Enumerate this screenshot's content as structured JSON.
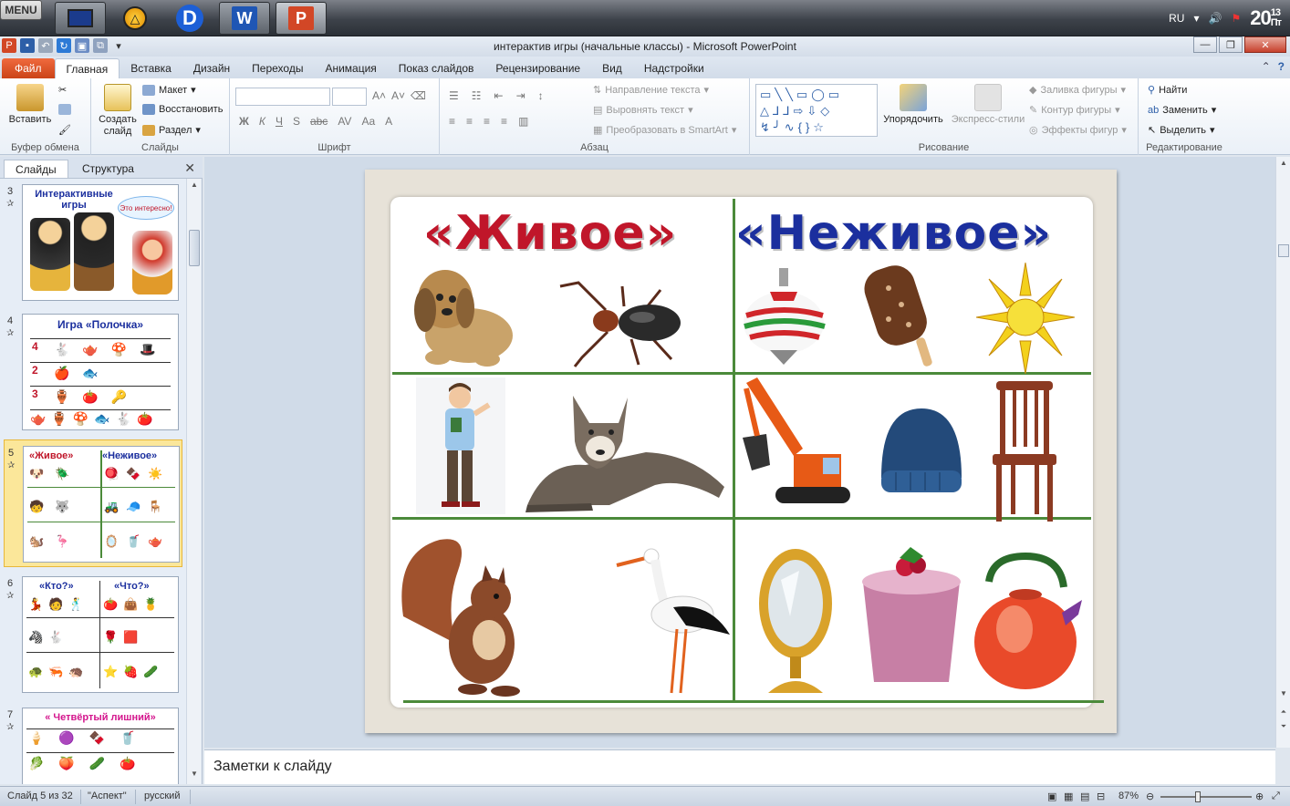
{
  "taskbar": {
    "menu_label": "MENU",
    "language": "RU",
    "clock_hour": "20",
    "clock_minutes": "13",
    "clock_suffix": "Пт"
  },
  "window": {
    "title": "интерактив игры (начальные классы)  -  Microsoft PowerPoint"
  },
  "ribbon_tabs": [
    "Файл",
    "Главная",
    "Вставка",
    "Дизайн",
    "Переходы",
    "Анимация",
    "Показ слайдов",
    "Рецензирование",
    "Вид",
    "Надстройки"
  ],
  "ribbon": {
    "clipboard": {
      "paste": "Вставить",
      "label": "Буфер обмена"
    },
    "slides": {
      "create": "Создать слайд",
      "layout": "Макет",
      "reset": "Восстановить",
      "section": "Раздел",
      "label": "Слайды"
    },
    "font": {
      "label": "Шрифт",
      "bold": "Ж",
      "italic": "К",
      "underline": "Ч",
      "strike": "S",
      "shadow": "abc",
      "spacing": "AV",
      "case": "Aa",
      "color": "A"
    },
    "paragraph": {
      "label": "Абзац",
      "text_direction": "Направление текста",
      "align_text": "Выровнять текст",
      "smartart": "Преобразовать в SmartArt"
    },
    "drawing": {
      "label": "Рисование",
      "arrange": "Упорядочить",
      "quick_styles": "Экспресс-стили",
      "fill": "Заливка фигуры",
      "outline": "Контур фигуры",
      "effects": "Эффекты фигур"
    },
    "editing": {
      "label": "Редактирование",
      "find": "Найти",
      "replace": "Заменить",
      "select": "Выделить"
    }
  },
  "pane": {
    "tab_slides": "Слайды",
    "tab_outline": "Структура",
    "thumbnails": [
      {
        "number": "3",
        "title": "Интерактивные игры",
        "bubble": "Это интересно!"
      },
      {
        "number": "4",
        "title": "Игра «Полочка»",
        "rows": [
          "4",
          "2",
          "3"
        ]
      },
      {
        "number": "5",
        "title_left": "«Живое»",
        "title_right": "«Неживое»"
      },
      {
        "number": "6",
        "title_left": "«Кто?»",
        "title_right": "«Что?»"
      },
      {
        "number": "7",
        "title": "« Четвёртый лишний»"
      }
    ]
  },
  "slide": {
    "heading_left": "«Живое»",
    "heading_right": "«Неживое»",
    "living": [
      "dog",
      "beetle",
      "boy",
      "wolf",
      "squirrel",
      "stork"
    ],
    "nonliving": [
      "spinning-top",
      "ice-cream",
      "sun",
      "excavator",
      "knit-hat",
      "chair",
      "mirror",
      "smoothie",
      "kettle"
    ]
  },
  "notes": {
    "placeholder": "Заметки к слайду"
  },
  "status": {
    "slide_info": "Слайд 5 из 32",
    "theme": "\"Аспект\"",
    "language": "русский",
    "zoom": "87%"
  },
  "colors": {
    "heading_live": "#c0162a",
    "heading_nonlive": "#1b2f9e",
    "grid_line": "#4b8a3a",
    "file_tab": "#d24726"
  }
}
